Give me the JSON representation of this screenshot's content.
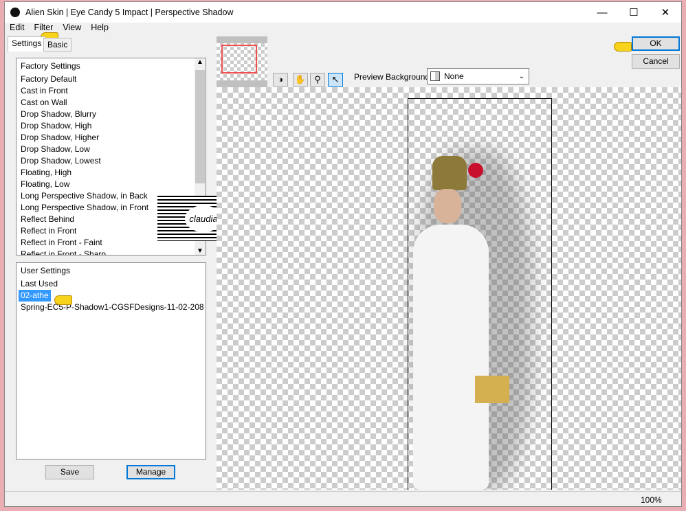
{
  "window": {
    "title": "Alien Skin | Eye Candy 5 Impact | Perspective Shadow"
  },
  "menu": [
    "Edit",
    "Filter",
    "View",
    "Help"
  ],
  "tabs": [
    "Settings",
    "Basic"
  ],
  "factory": {
    "header": "Factory Settings",
    "items": [
      "Factory Default",
      "Cast in Front",
      "Cast on Wall",
      "Drop Shadow, Blurry",
      "Drop Shadow, High",
      "Drop Shadow, Higher",
      "Drop Shadow, Low",
      "Drop Shadow, Lowest",
      "Floating, High",
      "Floating, Low",
      "Long Perspective Shadow, in Back",
      "Long Perspective Shadow, in Front",
      "Reflect Behind",
      "Reflect in Front",
      "Reflect in Front - Faint",
      "Reflect in Front - Sharp"
    ]
  },
  "user": {
    "header": "User Settings",
    "items": [
      "Last Used",
      "02-athe",
      "Spring-EC5-P-Shadow1-CGSFDesigns-11-02-208"
    ],
    "selected": "02-athe"
  },
  "buttons": {
    "save": "Save",
    "manage": "Manage",
    "ok": "OK",
    "cancel": "Cancel"
  },
  "preview": {
    "bg_label": "Preview Background:",
    "bg_value": "None"
  },
  "watermark": "claudia",
  "status": {
    "zoom": "100%"
  }
}
